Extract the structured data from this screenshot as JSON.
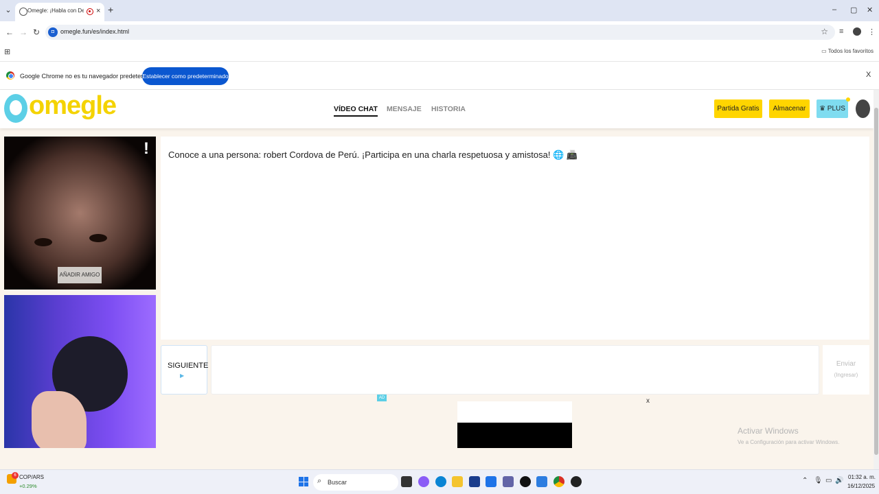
{
  "browser": {
    "tab_title": "Omegle: ¡Habla con Descor",
    "url": "omegle.fun/es/index.html",
    "bookmarks_label": "Todos los favoritos",
    "new_tab_symbol": "+",
    "close_symbol": "×"
  },
  "infobar": {
    "message": "Google Chrome no es tu navegador predeterminado",
    "button": "Establecer como predeterminado",
    "close": "X"
  },
  "site": {
    "logo": "omegle",
    "nav": [
      "VÍDEO CHAT",
      "MENSAJE",
      "HISTORIA"
    ],
    "btn_free": "Partida Gratis",
    "btn_store": "Almacenar",
    "btn_plus": "♛ PLUS",
    "alert": "!",
    "add_friend": "AÑADIR AMIGO",
    "chat_message": "Conoce a una persona: robert Cordova de Perú. ¡Participa en una charla respetuosa y amistosa! 🌐 📠",
    "next_label": "SIGUIENTE",
    "next_hint": "▶",
    "send_label": "Enviar",
    "send_hint": "(Ingresar)",
    "ad_badge": "AD",
    "ad_close": "x"
  },
  "windows": {
    "activate_title": "Activar Windows",
    "activate_sub": "Ve a Configuración para activar Windows.",
    "ticker_name": "COP/ARS",
    "ticker_change": "+0.29%",
    "ticker_badge": "6",
    "search_placeholder": "Buscar",
    "time": "01:32 a. m.",
    "date": "16/12/2025"
  },
  "colors": {
    "accent_yellow": "#ffd500",
    "accent_cyan": "#7fdcf0",
    "chrome_blue": "#0b57d0"
  }
}
